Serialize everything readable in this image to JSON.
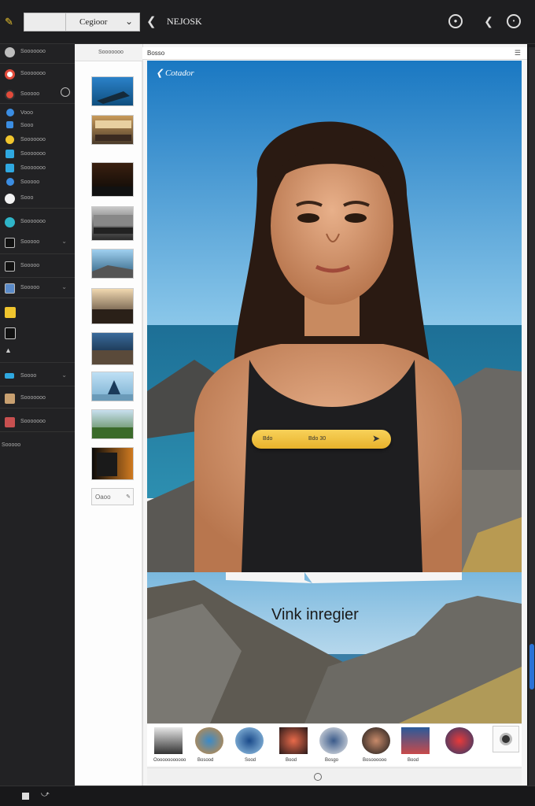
{
  "colors": {
    "accent": "#e8b22b",
    "dark_bg": "#1c1c1e",
    "scroll_thumb": "#2b73d6"
  },
  "toolbar": {
    "edit_icon": "pencil-icon",
    "select_value": "Cegioor",
    "app_title": "NEJOSK",
    "icons": [
      "target-icon",
      "phone-icon",
      "clock-icon",
      "ellipsis-icon"
    ]
  },
  "sidebar": {
    "items": [
      {
        "label": "Sooooooo",
        "icon": "circle-icon",
        "color": "#bdbdbd"
      },
      {
        "label": "Sooooooo",
        "icon": "record-icon",
        "color": "#e24b3b"
      },
      {
        "label": "Sooooo",
        "icon": "record-icon",
        "color": "#e24b3b"
      },
      {
        "label": "Vooo",
        "icon": "globe-icon",
        "color": "#3b8de2"
      },
      {
        "label": "Sooo",
        "icon": "square-icon",
        "color": "#3b8de2"
      },
      {
        "label": "Sooooooo",
        "icon": "star-icon",
        "color": "#f0c52e"
      },
      {
        "label": "Sooooooo",
        "icon": "square-icon",
        "color": "#2fa8e0"
      },
      {
        "label": "Sooooooo",
        "icon": "square-icon",
        "color": "#2fa8e0"
      },
      {
        "label": "Sooooo",
        "icon": "square-icon",
        "color": "#3b8de2"
      },
      {
        "label": "Sooo",
        "icon": "circle-icon",
        "color": "#f2f2f2"
      },
      {
        "label": "Sooooooo",
        "icon": "circle-icon",
        "color": "#2fb5c8"
      },
      {
        "label": "Sooooo",
        "icon": "square-icon",
        "color": "#bbbbbb"
      },
      {
        "label": "Sooooo",
        "icon": "square-icon",
        "color": "#bbbbbb"
      },
      {
        "label": "Sooooo",
        "icon": "square-icon",
        "color": "#5a8ac8"
      },
      {
        "label": "",
        "icon": "square-icon",
        "color": "#f0c52e"
      },
      {
        "label": "",
        "icon": "square-icon",
        "color": "#cccccc"
      },
      {
        "label": "",
        "icon": "triangle-icon",
        "color": "#cccccc"
      },
      {
        "label": "Soooo",
        "icon": "square-icon",
        "color": "#2fa8e0"
      },
      {
        "label": "Sooooooo",
        "icon": "square-icon",
        "color": "#c8a070"
      },
      {
        "label": "Sooooooo",
        "icon": "square-icon",
        "color": "#c85050"
      },
      {
        "label": "Sooooo",
        "icon": "",
        "color": ""
      }
    ]
  },
  "strip": {
    "header": "Sooooooo",
    "button_label": "Oaoo",
    "button_icon": "edit-icon"
  },
  "viewer": {
    "header_label": "Bosso",
    "header_icon": "menu-icon",
    "image_title": "Cotador",
    "pill": {
      "left": "Bdo",
      "middle": "Bdo 30",
      "arrow": "arrow-right-icon"
    },
    "landscape_title": "Vink inregier"
  },
  "bottom_thumbs": [
    {
      "label": "Oooooooooooo",
      "shape": "square"
    },
    {
      "label": "Bosood",
      "shape": "round"
    },
    {
      "label": "Sood",
      "shape": "round"
    },
    {
      "label": "Bood",
      "shape": "square"
    },
    {
      "label": "Bosgo",
      "shape": "round"
    },
    {
      "label": "Bosoooooo",
      "shape": "round"
    },
    {
      "label": "Bood",
      "shape": "square"
    },
    {
      "label": "",
      "shape": "round"
    }
  ]
}
